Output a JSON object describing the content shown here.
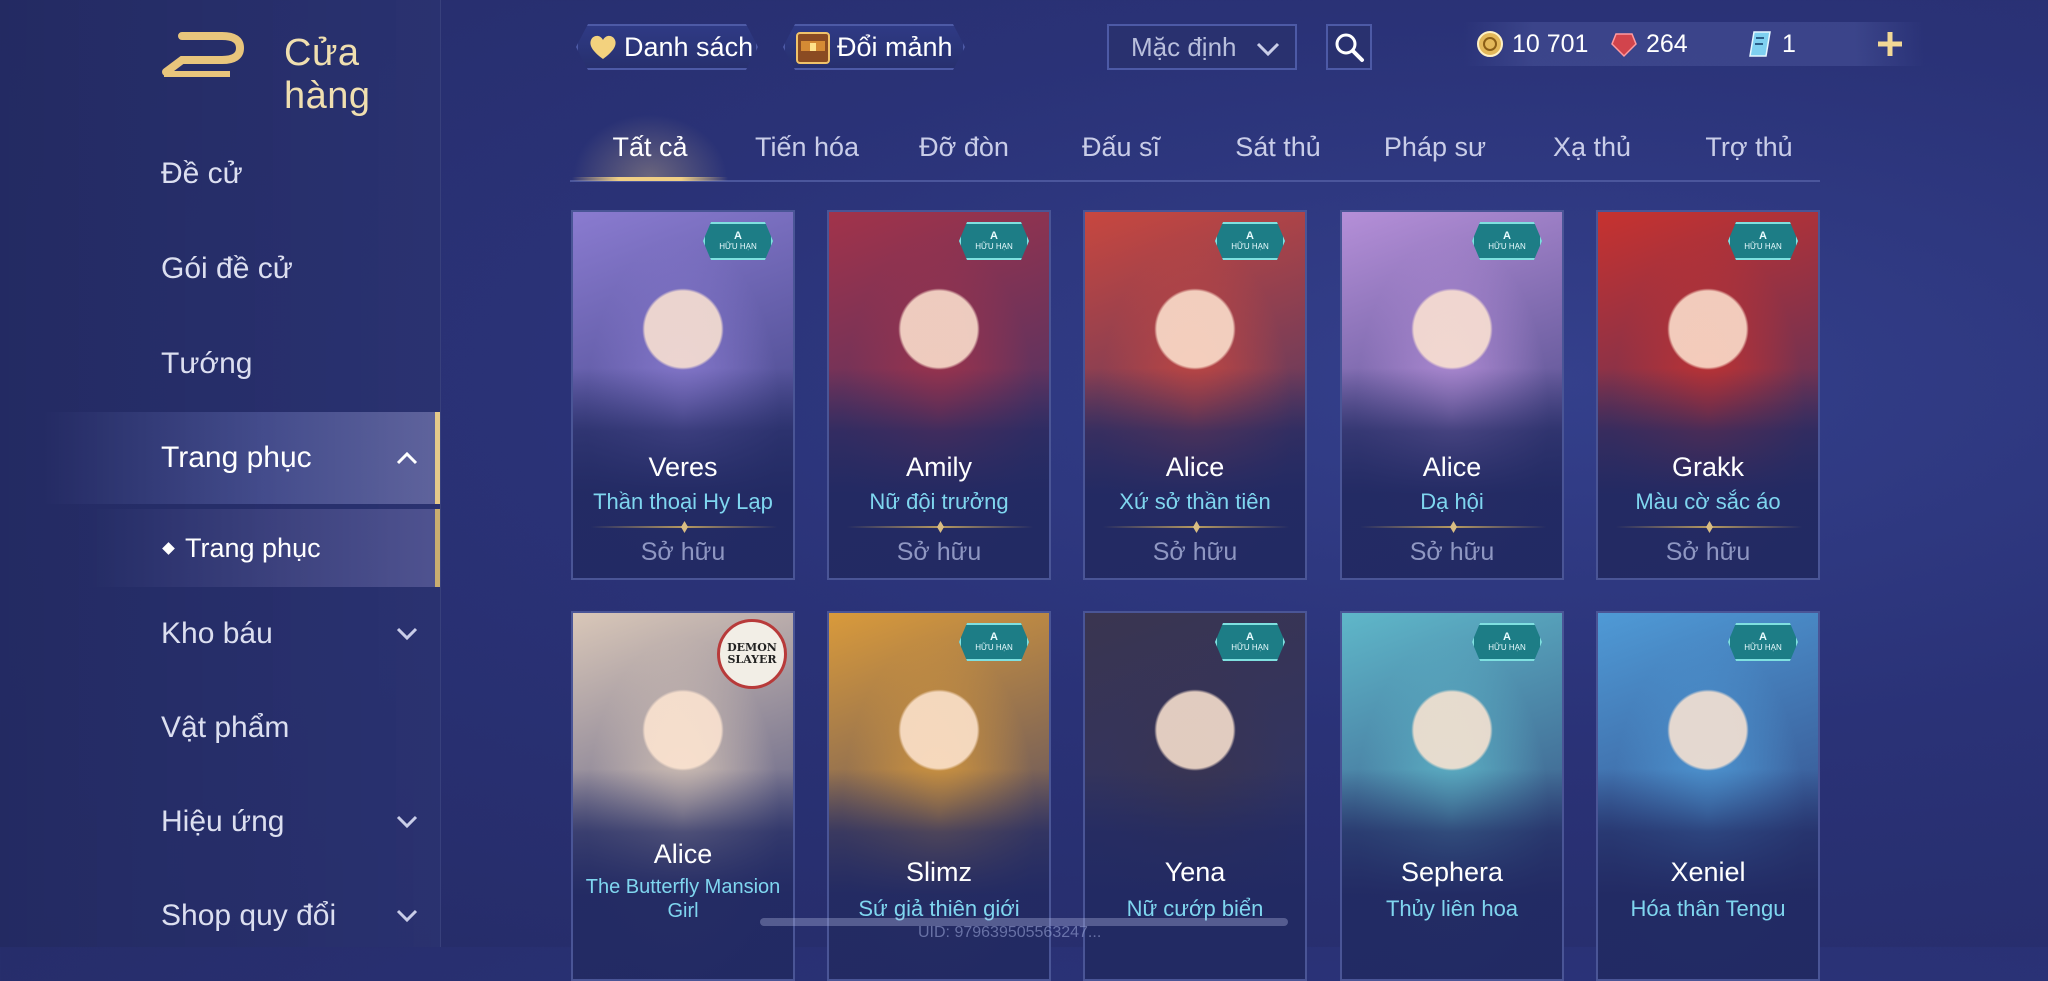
{
  "header": {
    "title": "Cửa hàng",
    "wishlist_label": "Danh sách",
    "exchange_label": "Đổi mảnh",
    "sort_value": "Mặc định"
  },
  "currency": {
    "gold": "10 701",
    "gems": "264",
    "vouchers": "1"
  },
  "sidebar": {
    "items": [
      {
        "label": "Đề cử"
      },
      {
        "label": "Gói đề cử"
      },
      {
        "label": "Tướng"
      },
      {
        "label": "Trang phục"
      },
      {
        "label": "Kho báu"
      },
      {
        "label": "Vật phẩm"
      },
      {
        "label": "Hiệu ứng"
      },
      {
        "label": "Shop quy đổi"
      }
    ],
    "sub_item": "Trang phục"
  },
  "tabs": [
    {
      "label": "Tất cả"
    },
    {
      "label": "Tiến hóa"
    },
    {
      "label": "Đỡ đòn"
    },
    {
      "label": "Đấu sĩ"
    },
    {
      "label": "Sát thủ"
    },
    {
      "label": "Pháp sư"
    },
    {
      "label": "Xạ thủ"
    },
    {
      "label": "Trợ thủ"
    }
  ],
  "badge": {
    "grade": "A",
    "text": "HỮU HẠN"
  },
  "collab_logo": "DEMON SLAYER",
  "cards": [
    {
      "hero": "Veres",
      "skin": "Thần thoại Hy Lạp",
      "status": "Sở hữu",
      "color": "#8a7bd0"
    },
    {
      "hero": "Amily",
      "skin": "Nữ đội trưởng",
      "status": "Sở hữu",
      "color": "#a2334a"
    },
    {
      "hero": "Alice",
      "skin": "Xứ sở thần tiên",
      "status": "Sở hữu",
      "color": "#c8473f"
    },
    {
      "hero": "Alice",
      "skin": "Dạ hội",
      "status": "Sở hữu",
      "color": "#b58fd8"
    },
    {
      "hero": "Grakk",
      "skin": "Màu cờ sắc áo",
      "status": "Sở hữu",
      "color": "#c7322f"
    },
    {
      "hero": "Alice",
      "skin": "The Butterfly Mansion Girl",
      "status": "",
      "color": "#d9c7b8"
    },
    {
      "hero": "Slimz",
      "skin": "Sứ giả thiên giới",
      "status": "",
      "color": "#d99a3b"
    },
    {
      "hero": "Yena",
      "skin": "Nữ cướp biển",
      "status": "",
      "color": "#3a3550"
    },
    {
      "hero": "Sephera",
      "skin": "Thủy liên hoa",
      "status": "",
      "color": "#5fb7c9"
    },
    {
      "hero": "Xeniel",
      "skin": "Hóa thân Tengu",
      "status": "",
      "color": "#4f9ad6"
    }
  ],
  "uid_text": "UID: 979639505563247..."
}
